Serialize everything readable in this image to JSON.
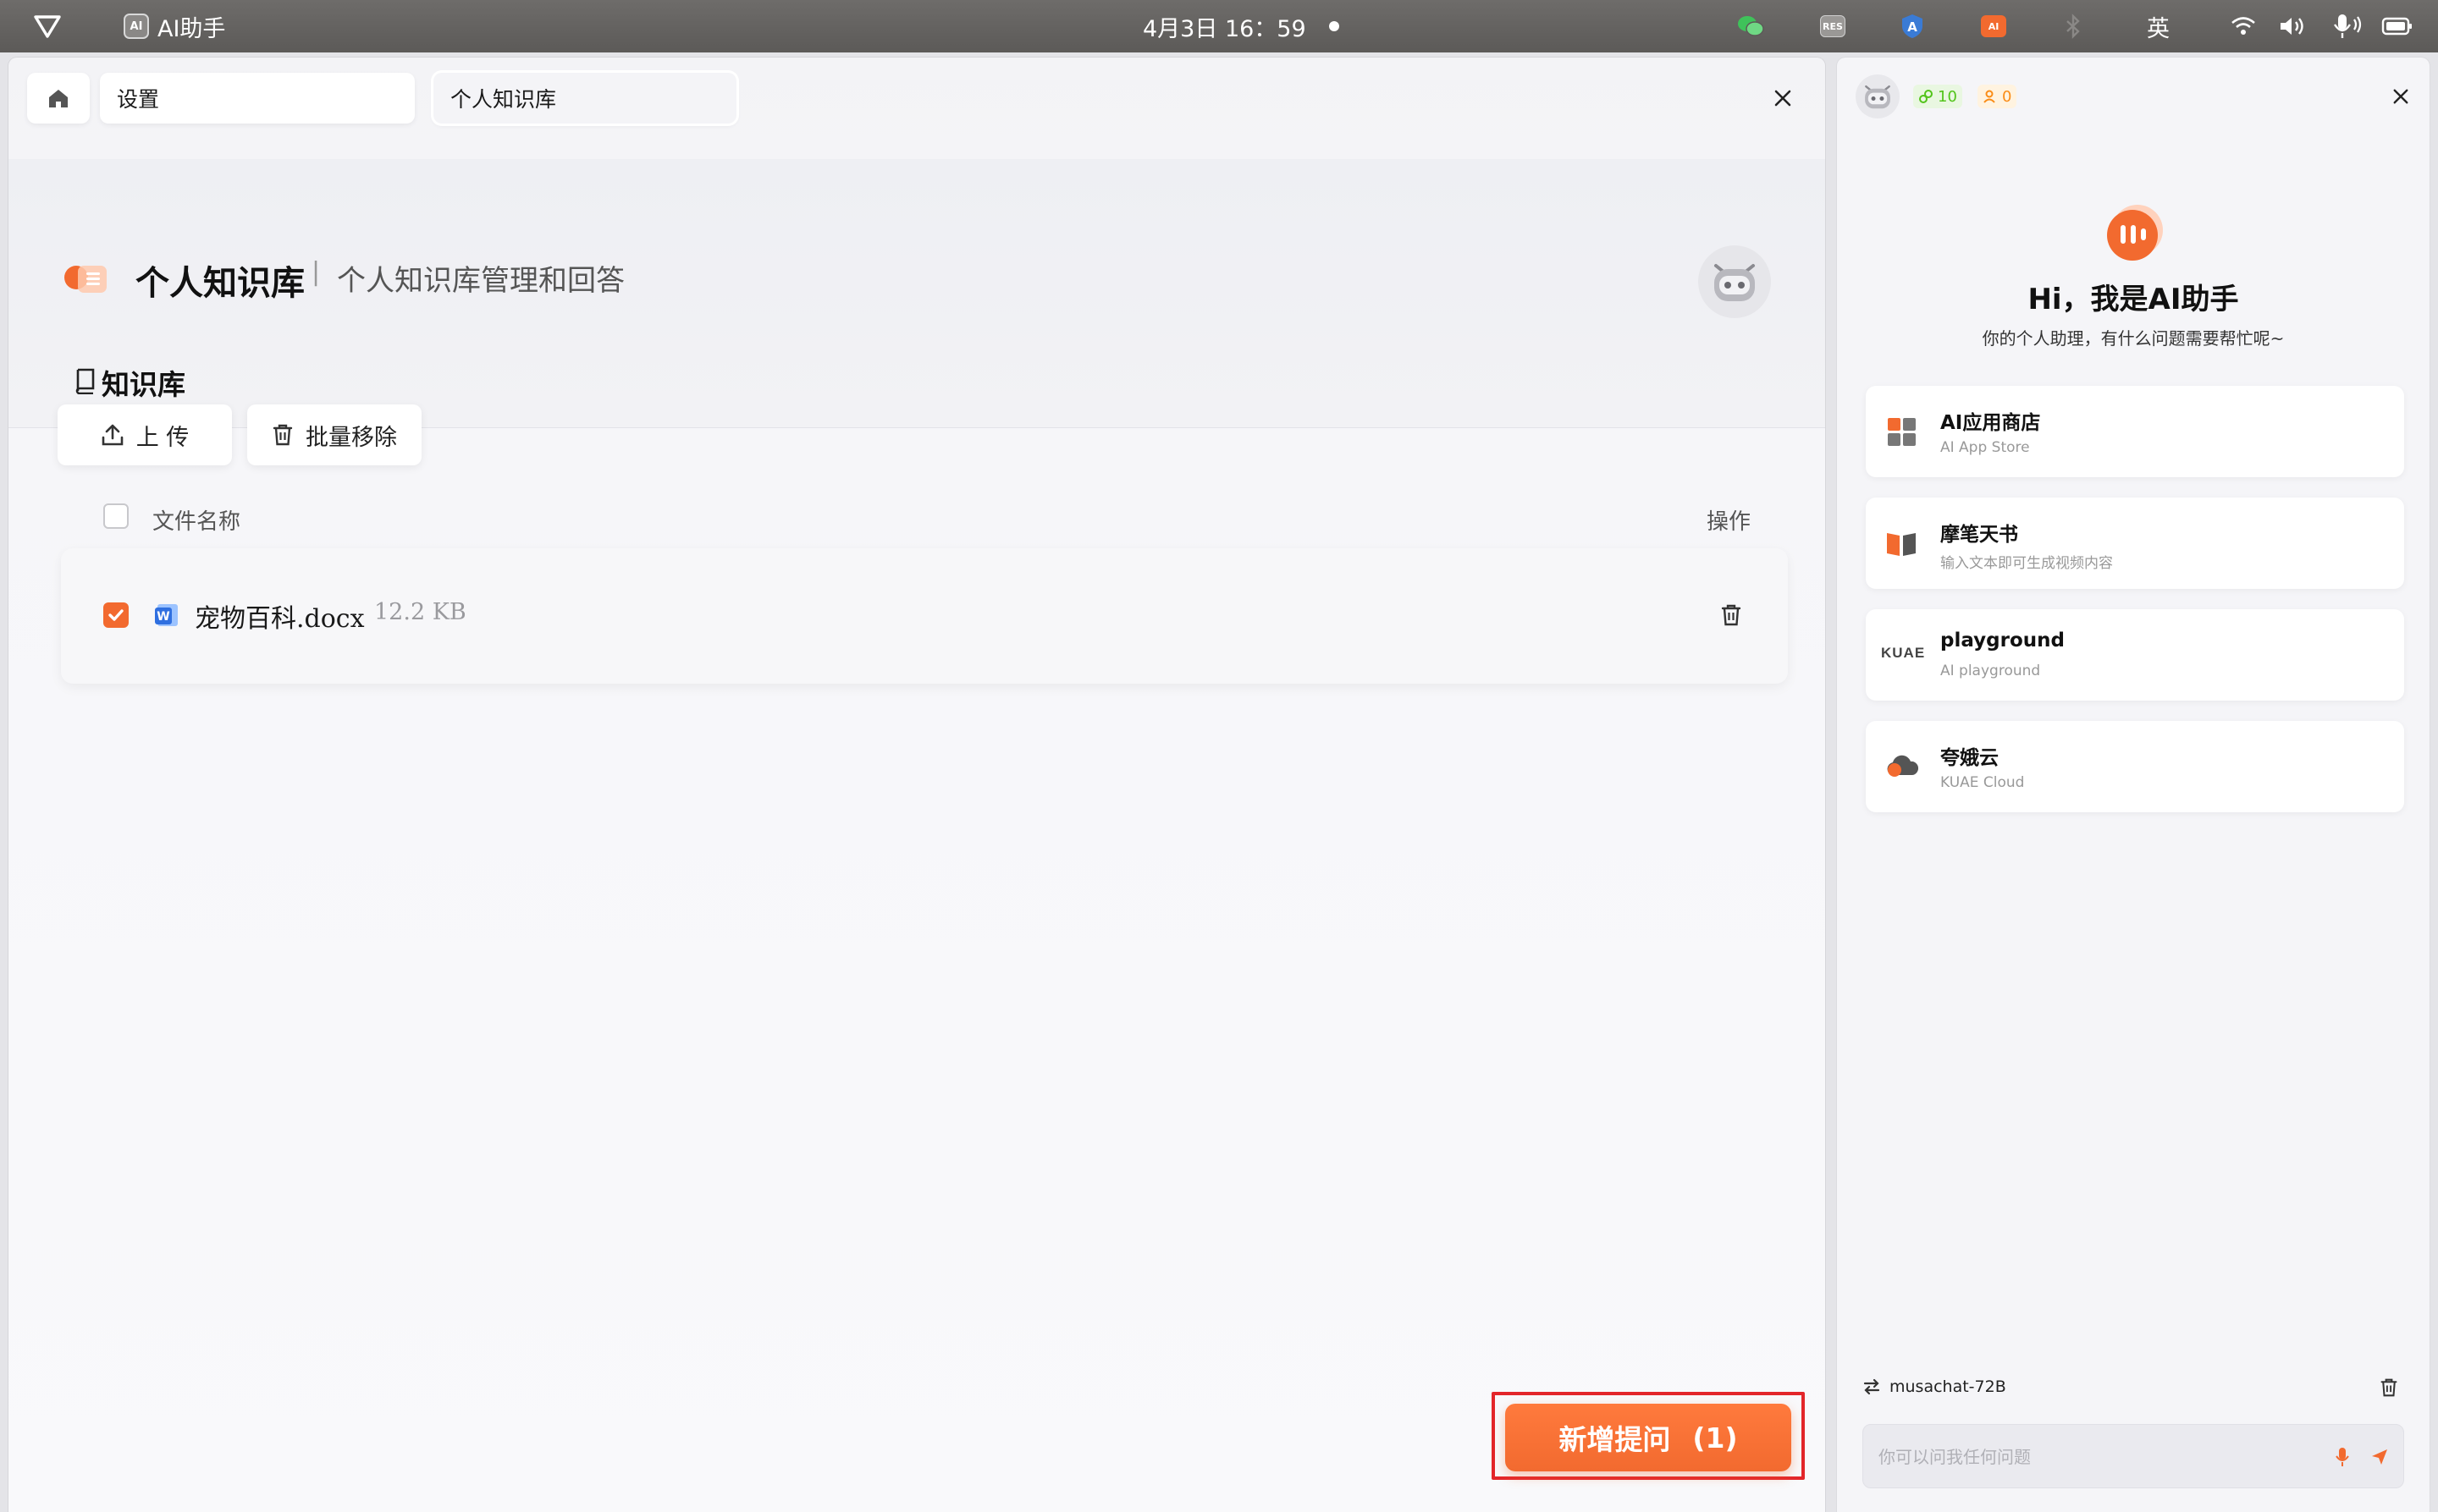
{
  "topbar": {
    "app_name": "AI助手",
    "app_chip": "AI",
    "datetime": "4月3日  16：59",
    "ime": "英"
  },
  "breadcrumb": {
    "item1": "设置",
    "item2": "个人知识库"
  },
  "header": {
    "title": "个人知识库",
    "separator": "|",
    "subtitle": "个人知识库管理和回答",
    "tab_label": "知识库"
  },
  "toolbar": {
    "upload_label": "上 传",
    "batch_remove_label": "批量移除"
  },
  "table": {
    "col_name": "文件名称",
    "col_actions": "操作",
    "rows": [
      {
        "file_name": "宠物百科.docx",
        "size": "12.2 KB",
        "checked": true,
        "icon": "word-doc-icon"
      }
    ]
  },
  "submit": {
    "label": "新增提问",
    "count": "(1)"
  },
  "assistant": {
    "badge_points": "10",
    "badge_users": "0",
    "greeting": "Hi，我是AI助手",
    "subgreeting": "你的个人助理，有什么问题需要帮忙呢~",
    "cards": [
      {
        "title": "AI应用商店",
        "subtitle": "AI App Store",
        "icon": "app-store-icon"
      },
      {
        "title": "摩笔天书",
        "subtitle": "输入文本即可生成视频内容",
        "icon": "book-icon"
      },
      {
        "title": "playground",
        "subtitle": "AI playground",
        "icon": "kuae-logo",
        "logo_text": "KUAE"
      },
      {
        "title": "夸娥云",
        "subtitle": "KUAE Cloud",
        "icon": "cloud-icon"
      }
    ],
    "model_name": "musachat-72B",
    "input_placeholder": "你可以问我任何问题"
  },
  "colors": {
    "accent": "#f26a2f",
    "highlight_border": "#e3262a",
    "badge_green": "#52c41a",
    "badge_orange": "#fa8c16"
  }
}
